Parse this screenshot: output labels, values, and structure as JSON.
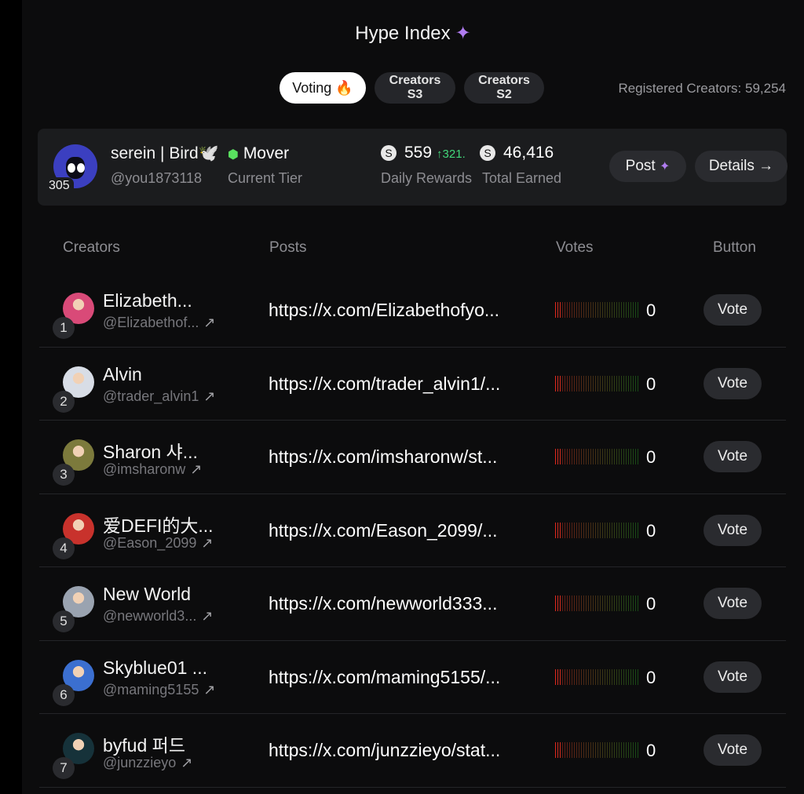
{
  "header": {
    "title": "Hype Index",
    "title_icon": "sparkle-icon",
    "accent": "#b07cf0"
  },
  "tabs": [
    {
      "label": "Voting",
      "icon": "flame-icon",
      "active": true
    },
    {
      "label_line1": "Creators",
      "label_line2": "S3",
      "active": false
    },
    {
      "label_line1": "Creators",
      "label_line2": "S2",
      "active": false
    }
  ],
  "registered": "Registered Creators: 59,254",
  "me": {
    "rank": "305",
    "name": "serein | Bird🕊️",
    "handle": "@you1873118",
    "tier_icon": "hex-badge-icon",
    "tier": "Mover",
    "tier_label": "Current Tier",
    "daily_rewards": "559",
    "daily_delta": "↑321.",
    "daily_label": "Daily Rewards",
    "total_earned": "46,416",
    "total_label": "Total Earned",
    "post_label": "Post",
    "details_label": "Details →"
  },
  "columns": {
    "creators": "Creators",
    "posts": "Posts",
    "votes": "Votes",
    "button": "Button"
  },
  "creators": [
    {
      "rank": "1",
      "name": "Elizabeth...",
      "handle": "@Elizabethof...",
      "post": "https://x.com/Elizabethofyo...",
      "votes": "0",
      "vote_label": "Vote",
      "avatar_color": "#d94a78"
    },
    {
      "rank": "2",
      "name": "Alvin",
      "handle": "@trader_alvin1",
      "post": "https://x.com/trader_alvin1/...",
      "votes": "0",
      "vote_label": "Vote",
      "avatar_color": "#d8dde6"
    },
    {
      "rank": "3",
      "name": "Sharon 샤...",
      "handle": "@imsharonw",
      "post": "https://x.com/imsharonw/st...",
      "votes": "0",
      "vote_label": "Vote",
      "avatar_color": "#7c7a3c"
    },
    {
      "rank": "4",
      "name": "爱DEFI的大...",
      "handle": "@Eason_2099",
      "post": "https://x.com/Eason_2099/...",
      "votes": "0",
      "vote_label": "Vote",
      "avatar_color": "#c8322c"
    },
    {
      "rank": "5",
      "name": "New World",
      "handle": "@newworld3...",
      "post": "https://x.com/newworld333...",
      "votes": "0",
      "vote_label": "Vote",
      "avatar_color": "#9aa3b0"
    },
    {
      "rank": "6",
      "name": "Skyblue01 ...",
      "handle": "@maming5155",
      "post": "https://x.com/maming5155/...",
      "votes": "0",
      "vote_label": "Vote",
      "avatar_color": "#3b6fd0"
    },
    {
      "rank": "7",
      "name": "byfud 퍼드",
      "handle": "@junzzieyo",
      "post": "https://x.com/junzzieyo/stat...",
      "votes": "0",
      "vote_label": "Vote",
      "avatar_color": "#16323a"
    }
  ]
}
